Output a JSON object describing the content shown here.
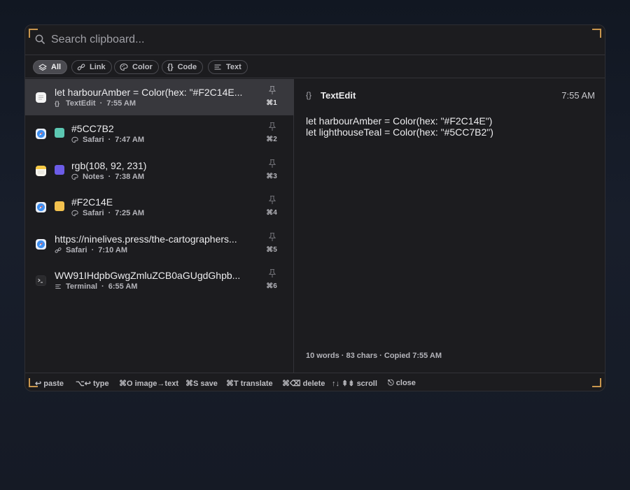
{
  "search": {
    "placeholder": "Search clipboard..."
  },
  "filters": [
    {
      "label": "All",
      "icon": "stack-icon",
      "active": true
    },
    {
      "label": "Link",
      "icon": "link-icon",
      "active": false
    },
    {
      "label": "Color",
      "icon": "palette-icon",
      "active": false
    },
    {
      "label": "Code",
      "icon": "braces-icon",
      "active": false
    },
    {
      "label": "Text",
      "icon": "text-lines-icon",
      "active": false
    }
  ],
  "items": [
    {
      "title": "let harbourAmber = Color(hex: \"#F2C14E...",
      "app": "TextEdit",
      "time": "7:55 AM",
      "type": "code",
      "app_icon": "textedit-icon",
      "shortcut": "⌘1",
      "selected": true
    },
    {
      "title": "#5CC7B2",
      "app": "Safari",
      "time": "7:47 AM",
      "type": "color",
      "swatch": "#5CC7B2",
      "app_icon": "safari-icon",
      "shortcut": "⌘2"
    },
    {
      "title": "rgb(108, 92, 231)",
      "app": "Notes",
      "time": "7:38 AM",
      "type": "color",
      "swatch": "#6C5CE7",
      "app_icon": "notes-icon",
      "shortcut": "⌘3"
    },
    {
      "title": "#F2C14E",
      "app": "Safari",
      "time": "7:25 AM",
      "type": "color",
      "swatch": "#F2C14E",
      "app_icon": "safari-icon",
      "shortcut": "⌘4"
    },
    {
      "title": "https://ninelives.press/the-cartographers...",
      "app": "Safari",
      "time": "7:10 AM",
      "type": "link",
      "app_icon": "safari-icon",
      "shortcut": "⌘5"
    },
    {
      "title": "WW91IHdpbGwgZmluZCB0aGUgdGhpb...",
      "app": "Terminal",
      "time": "6:55 AM",
      "type": "text",
      "app_icon": "terminal-icon",
      "shortcut": "⌘6"
    }
  ],
  "preview": {
    "type_icon": "{}",
    "app": "TextEdit",
    "time": "7:55 AM",
    "content_lines": [
      "let harbourAmber = Color(hex: \"#F2C14E\")",
      "let lighthouseTeal = Color(hex: \"#5CC7B2\")"
    ],
    "footer": "10 words · 83 chars  ·  Copied 7:55 AM"
  },
  "hints": [
    {
      "key": "↩",
      "label": "paste"
    },
    {
      "key": "⌥↩",
      "label": "type"
    },
    {
      "key": "⌘O",
      "label": "image→text"
    },
    {
      "key": "⌘S",
      "label": "save"
    },
    {
      "key": "⌘T",
      "label": "translate"
    },
    {
      "key": "⌘⌫",
      "label": "delete"
    },
    {
      "key": "↑↓ ⇞⇟",
      "label": "scroll"
    },
    {
      "key": "⎋",
      "label": "close"
    }
  ],
  "colors": {
    "accent": "#C9964D",
    "selected_row": "#38383D"
  }
}
